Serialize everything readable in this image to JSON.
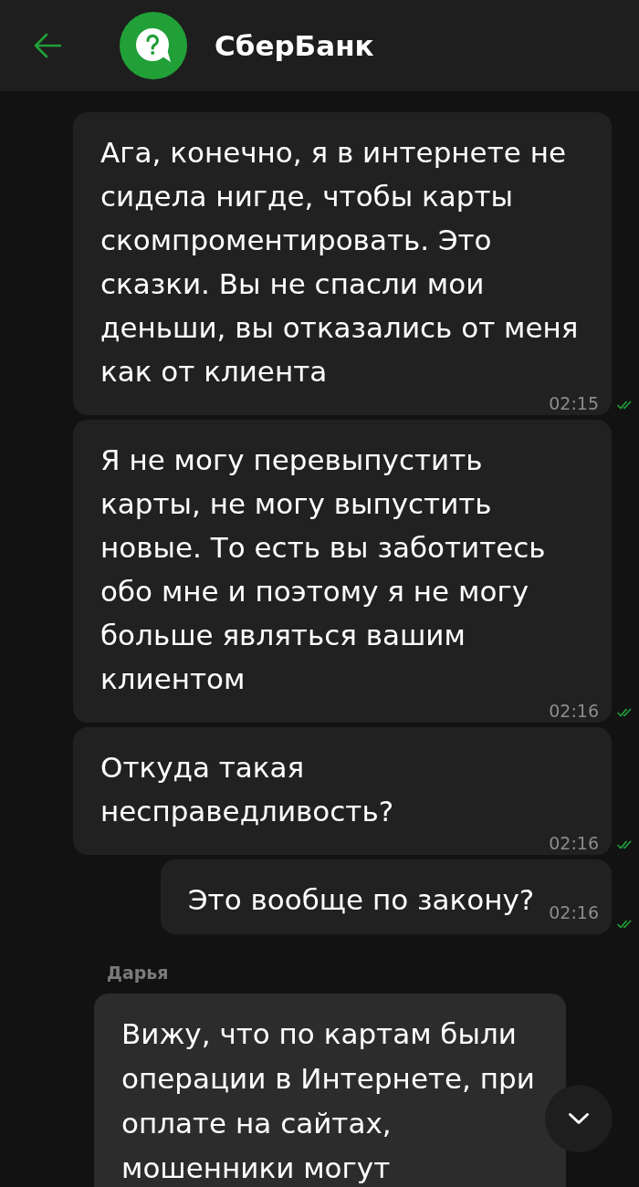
{
  "header": {
    "title": "СберБанк"
  },
  "messages": [
    {
      "kind": "outgoing",
      "text": "Ага, конечно, я в интернете не\nсидела нигде, чтобы карты\nскомпроментировать. Это\nсказки. Вы не спасли мои\nденьши, вы отказались от меня\nкак от клиента",
      "time": "02:15",
      "read": true
    },
    {
      "kind": "outgoing",
      "text": "Я не могу перевыпустить\nкарты, не могу выпустить\nновые. То есть вы заботитесь\nобо мне и поэтому я не могу\nбольше являться вашим\nклиентом",
      "time": "02:16",
      "read": true
    },
    {
      "kind": "outgoing",
      "text": "Откуда такая\nнесправедливость?",
      "time": "02:16",
      "read": true
    },
    {
      "kind": "outgoing",
      "text": "Это вообще по закону?",
      "time": "02:16",
      "read": true
    },
    {
      "kind": "incoming",
      "sender": "Дарья",
      "text": "Вижу, что по картам были\nоперации в Интернете, при\nоплате на сайтах,\nмошенники могут"
    }
  ]
}
